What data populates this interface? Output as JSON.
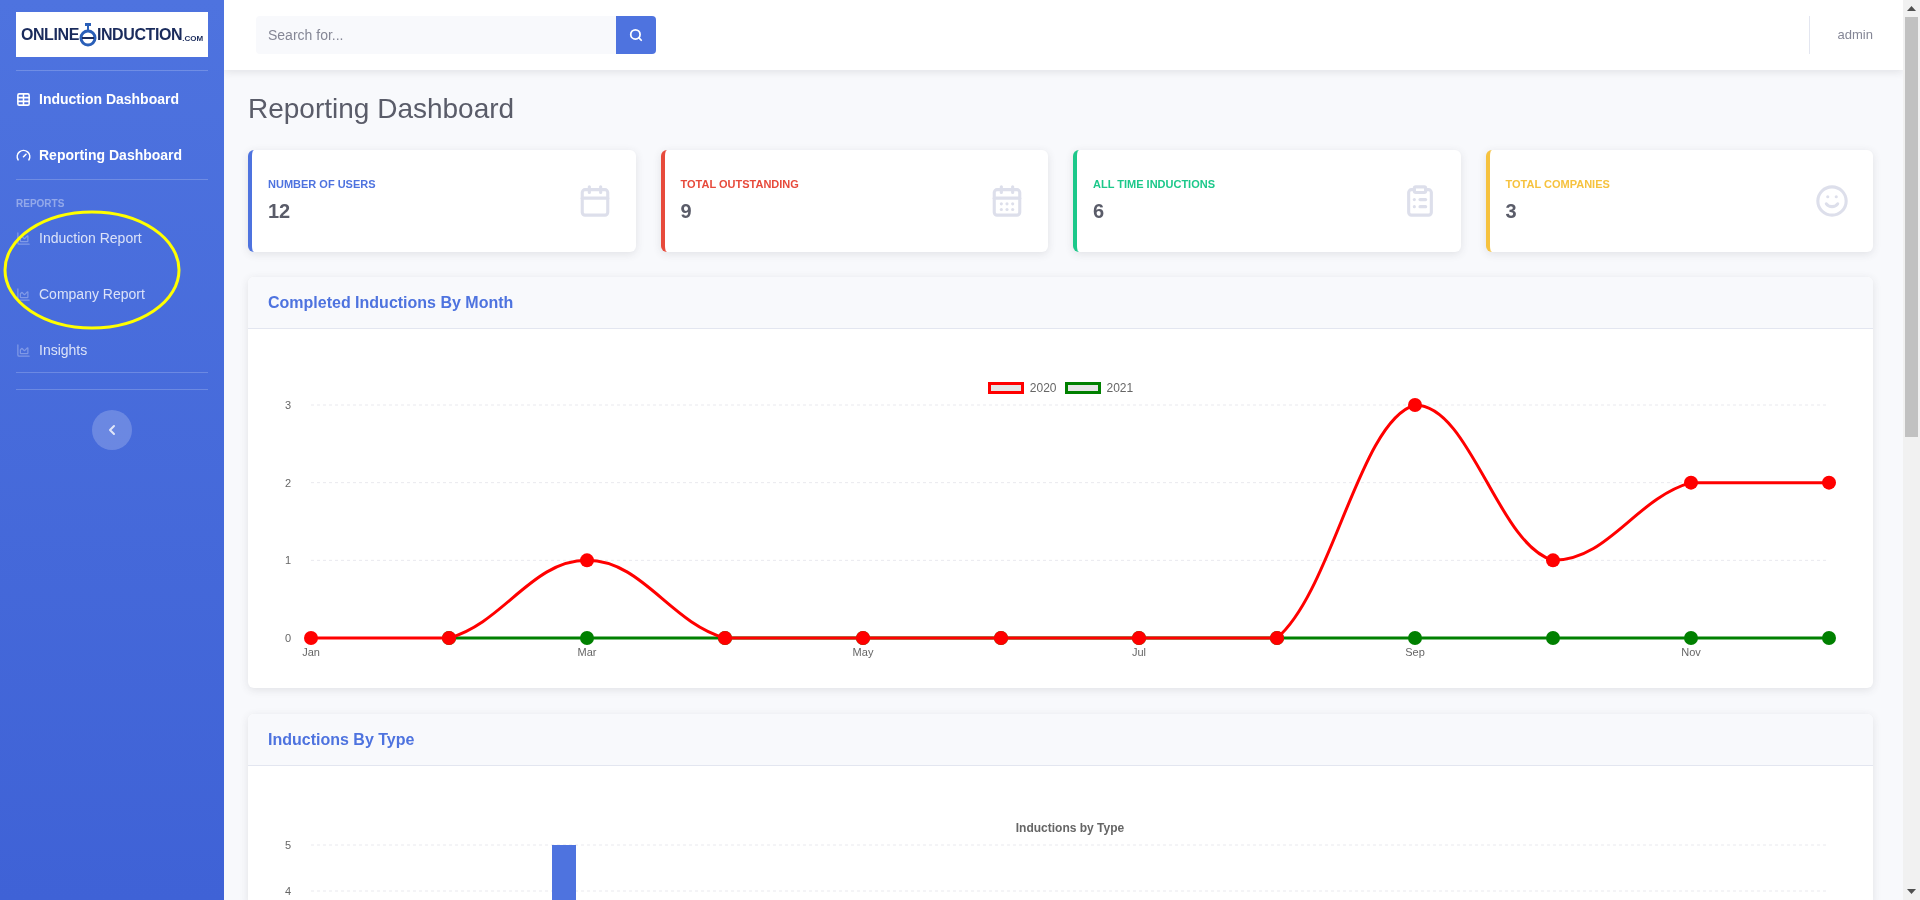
{
  "logo": {
    "left": "ONLINE",
    "right": "INDUCTION",
    "suffix": ".COM"
  },
  "sidebar": {
    "primary": [
      {
        "label": "Induction Dashboard"
      },
      {
        "label": "Reporting Dashboard"
      }
    ],
    "section_heading": "REPORTS",
    "reports": [
      {
        "label": "Induction Report"
      },
      {
        "label": "Company Report"
      },
      {
        "label": "Insights"
      }
    ]
  },
  "search": {
    "placeholder": "Search for..."
  },
  "user": "admin",
  "page_title": "Reporting Dashboard",
  "stat_cards": [
    {
      "label": "NUMBER OF USERS",
      "value": "12",
      "color": "#4e73df"
    },
    {
      "label": "TOTAL OUTSTANDING",
      "value": "9",
      "color": "#e74a3b"
    },
    {
      "label": "ALL TIME INDUCTIONS",
      "value": "6",
      "color": "#1cc88a"
    },
    {
      "label": "TOTAL COMPANIES",
      "value": "3",
      "color": "#f6c23e"
    }
  ],
  "monthly_card": {
    "title": "Completed Inductions By Month",
    "chart_data": {
      "type": "line",
      "categories": [
        "Jan",
        null,
        "Mar",
        null,
        "May",
        null,
        "Jul",
        null,
        "Sep",
        null,
        "Nov",
        null
      ],
      "ylim": [
        0,
        3
      ],
      "legend": "top",
      "yticks": [
        0,
        1,
        2,
        3
      ],
      "series": [
        {
          "name": "2020",
          "color": "#ff0000",
          "marker": "circle",
          "values": [
            0,
            0,
            1,
            0,
            0,
            0,
            0,
            0,
            3,
            1,
            2,
            2
          ]
        },
        {
          "name": "2021",
          "color": "#008000",
          "marker": "circle",
          "values": [
            null,
            0,
            0,
            0,
            0,
            0,
            0,
            0,
            0,
            0,
            0,
            0
          ]
        }
      ]
    }
  },
  "type_card": {
    "title": "Inductions By Type",
    "chart_title": "Inductions by Type",
    "axis_labels": [
      "5",
      "4"
    ]
  }
}
